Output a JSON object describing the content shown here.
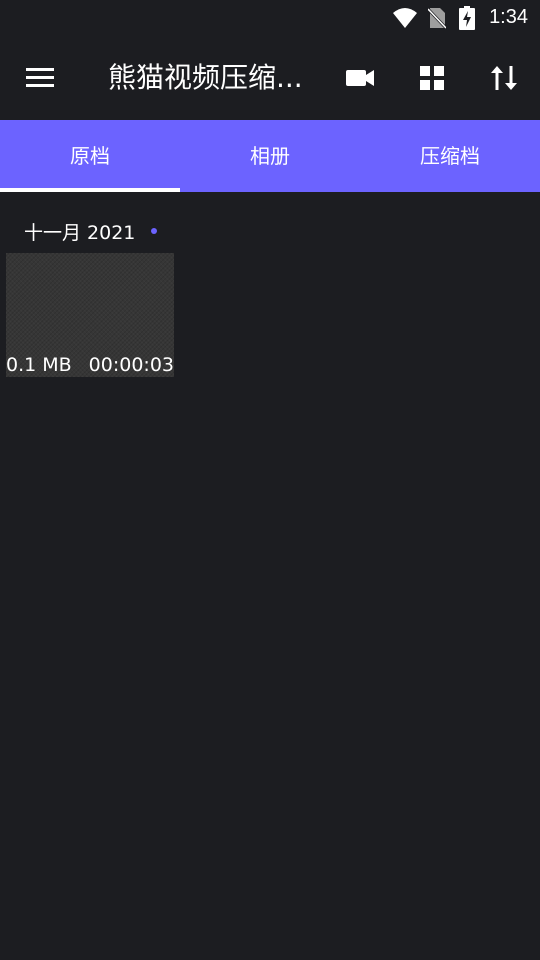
{
  "status_bar": {
    "time": "1:34",
    "icons": [
      "wifi-icon",
      "no-sim-icon",
      "battery-charging-icon"
    ]
  },
  "toolbar": {
    "title": "熊猫视频压缩...",
    "menu_icon": "hamburger-menu-icon",
    "actions": [
      "video-camera-icon",
      "grid-view-icon",
      "sort-icon"
    ]
  },
  "tabs": [
    {
      "label": "原档",
      "active": true
    },
    {
      "label": "相册",
      "active": false
    },
    {
      "label": "压缩档",
      "active": false
    }
  ],
  "content": {
    "groups": [
      {
        "header": "十一月 2021",
        "items": [
          {
            "size": "0.1 MB",
            "duration": "00:00:03"
          }
        ]
      }
    ]
  },
  "colors": {
    "background": "#1c1d21",
    "accent": "#6c63ff",
    "text": "#ffffff"
  }
}
